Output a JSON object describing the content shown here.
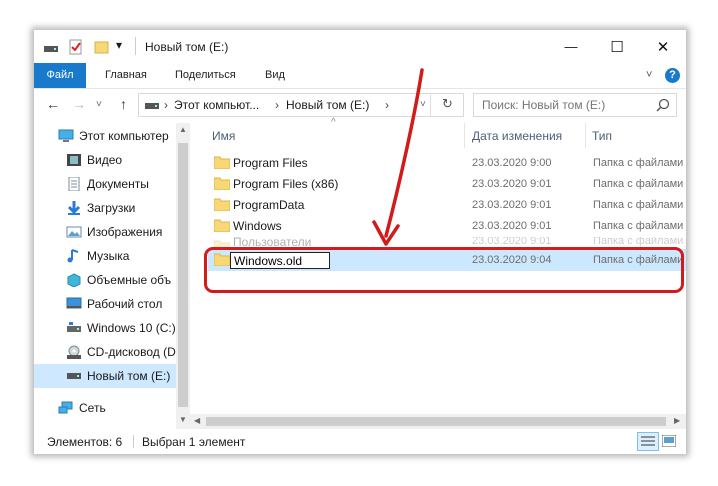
{
  "window": {
    "title": "Новый том (E:)",
    "controls": {
      "minimize": "—",
      "maximize": "☐",
      "close": "✕"
    }
  },
  "ribbon": {
    "tabs": [
      "Файл",
      "Главная",
      "Поделиться",
      "Вид"
    ],
    "caret": "˅",
    "help": "?"
  },
  "address": {
    "path": [
      "Этот компьют...",
      "Новый том (E:)"
    ],
    "separator": "›",
    "search_placeholder": "Поиск: Новый том (E:)"
  },
  "nav": {
    "items": [
      {
        "label": "Этот компьютер",
        "icon": "computer-icon"
      },
      {
        "label": "Видео",
        "icon": "video-icon"
      },
      {
        "label": "Документы",
        "icon": "documents-icon"
      },
      {
        "label": "Загрузки",
        "icon": "downloads-icon"
      },
      {
        "label": "Изображения",
        "icon": "pictures-icon"
      },
      {
        "label": "Музыка",
        "icon": "music-icon"
      },
      {
        "label": "Объемные объ",
        "icon": "3d-objects-icon"
      },
      {
        "label": "Рабочий стол",
        "icon": "desktop-icon"
      },
      {
        "label": "Windows 10 (C:)",
        "icon": "drive-icon"
      },
      {
        "label": "CD-дисковод (D",
        "icon": "cd-drive-icon"
      },
      {
        "label": "Новый том (E:)",
        "icon": "drive-icon",
        "selected": true
      },
      {
        "label": "Сеть",
        "icon": "network-icon"
      }
    ]
  },
  "columns": {
    "name": "Имя",
    "date": "Дата изменения",
    "type": "Тип"
  },
  "files": [
    {
      "name": "Program Files",
      "date": "23.03.2020 9:00",
      "type": "Папка с файлами"
    },
    {
      "name": "Program Files (x86)",
      "date": "23.03.2020 9:01",
      "type": "Папка с файлами"
    },
    {
      "name": "ProgramData",
      "date": "23.03.2020 9:01",
      "type": "Папка с файлами"
    },
    {
      "name": "Windows",
      "date": "23.03.2020 9:01",
      "type": "Папка с файлами"
    },
    {
      "name": "Пользователи",
      "date": "23.03.2020 9:01",
      "type": "Папка с файлами"
    },
    {
      "name": "Windows.old",
      "date": "23.03.2020 9:04",
      "type": "Папка с файлами",
      "selected": true,
      "renaming": true
    }
  ],
  "status": {
    "count": "Элементов: 6",
    "selection": "Выбран 1 элемент"
  },
  "colors": {
    "accent": "#1979ca",
    "selection": "#cce8ff",
    "highlight": "#d21b1b",
    "folder": "#f8d775"
  }
}
